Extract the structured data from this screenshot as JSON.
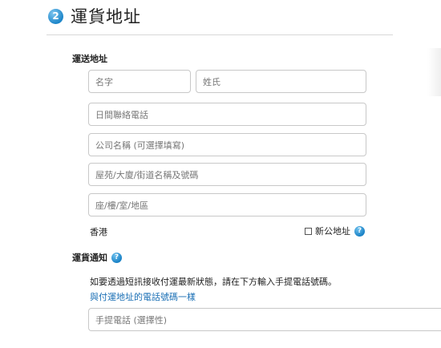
{
  "step": {
    "number": "2",
    "title": "運貨地址"
  },
  "shipping_address": {
    "heading": "運送地址",
    "first_name_placeholder": "名字",
    "last_name_placeholder": "姓氏",
    "phone_placeholder": "日間聯絡電話",
    "company_placeholder": "公司名稱 (可選擇填寫)",
    "street_placeholder": "屋苑/大廈/街道名稱及號碼",
    "area_placeholder": "座/樓/室/地區",
    "region": "香港",
    "company_address_label": "新公地址"
  },
  "notification": {
    "heading": "運貨通知",
    "instructions": "如要透過短訊接收付運最新狀態，請在下方輸入手提電話號碼。",
    "same_phone_link": "與付運地址的電話號碼一樣",
    "mobile_placeholder": "手提電話 (選擇性)"
  },
  "icons": {
    "help": "?"
  },
  "colors": {
    "accent": "#1d86c9",
    "link": "#1a6fb5",
    "border": "#c8c8c8"
  }
}
